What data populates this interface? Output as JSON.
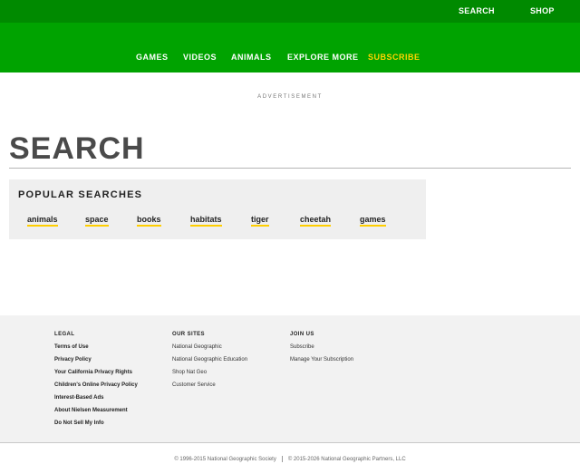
{
  "top_bar": {
    "search_label": "SEARCH",
    "shop_label": "SHOP"
  },
  "nav": {
    "items": [
      {
        "label": "GAMES"
      },
      {
        "label": "VIDEOS"
      },
      {
        "label": "ANIMALS"
      },
      {
        "label": "EXPLORE MORE"
      },
      {
        "label": "SUBSCRIBE"
      }
    ],
    "subscribe_color": "#ffd400"
  },
  "ad_label": "ADVERTISEMENT",
  "page_title": "SEARCH",
  "popular": {
    "heading": "POPULAR SEARCHES",
    "terms": [
      "animals",
      "space",
      "books",
      "habitats",
      "tiger",
      "cheetah",
      "games"
    ]
  },
  "footer": {
    "legal": {
      "heading": "LEGAL",
      "links": [
        "Terms of Use",
        "Privacy Policy",
        "Your California Privacy Rights",
        "Children's Online Privacy Policy",
        "Interest-Based Ads",
        "About Nielsen Measurement",
        "Do Not Sell My Info"
      ]
    },
    "our_sites": {
      "heading": "OUR SITES",
      "links": [
        "National Geographic",
        "National Geographic Education",
        "Shop Nat Geo",
        "Customer Service"
      ]
    },
    "join_us": {
      "heading": "JOIN US",
      "links": [
        "Subscribe",
        "Manage Your Subscription"
      ]
    }
  },
  "copyright": {
    "society": "© 1996-2015 National Geographic Society",
    "partners": "© 2015-2026 National Geographic Partners, LLC"
  },
  "colors": {
    "top_bar": "#008a00",
    "nav_bar": "#00a300",
    "accent_underline": "#ffce00"
  }
}
